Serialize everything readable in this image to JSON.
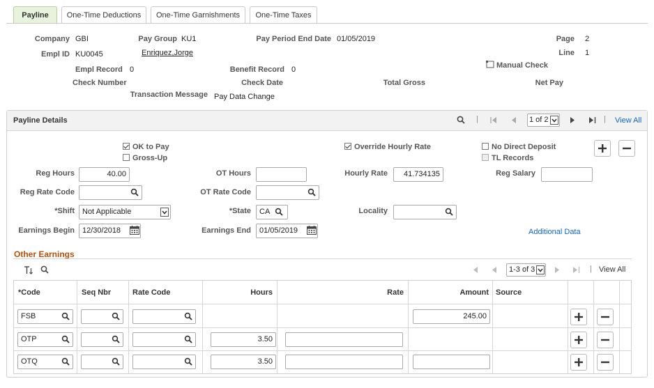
{
  "tabs": [
    {
      "label": "Payline"
    },
    {
      "label": "One-Time Deductions"
    },
    {
      "label": "One-Time Garnishments"
    },
    {
      "label": "One-Time Taxes"
    }
  ],
  "header": {
    "company_label": "Company",
    "company_value": "GBI",
    "pay_group_label": "Pay Group",
    "pay_group_value": "KU1",
    "pay_period_label": "Pay Period End Date",
    "pay_period_value": "01/05/2019",
    "page_label": "Page",
    "page_value": "2",
    "empl_id_label": "Empl ID",
    "empl_id_value": "KU0045",
    "name_value": "Enriquez,Jorge",
    "line_label": "Line",
    "line_value": "1",
    "manual_check_label": "Manual Check",
    "empl_record_label": "Empl Record",
    "empl_record_value": "0",
    "benefit_record_label": "Benefit Record",
    "benefit_record_value": "0",
    "check_number_label": "Check Number",
    "check_date_label": "Check Date",
    "total_gross_label": "Total Gross",
    "net_pay_label": "Net Pay",
    "transaction_message_label": "Transaction Message",
    "transaction_message_value": "Pay Data Change"
  },
  "details": {
    "title": "Payline Details",
    "pager": "1 of 2",
    "view_all": "View All",
    "ok_to_pay": "OK to Pay",
    "gross_up": "Gross-Up",
    "override_hourly_rate": "Override Hourly Rate",
    "no_direct_deposit": "No Direct Deposit",
    "tl_records": "TL Records",
    "reg_hours_label": "Reg Hours",
    "reg_hours_value": "40.00",
    "ot_hours_label": "OT Hours",
    "ot_hours_value": "",
    "hourly_rate_label": "Hourly Rate",
    "hourly_rate_value": "41.734135",
    "reg_salary_label": "Reg Salary",
    "reg_salary_value": "",
    "reg_rate_code_label": "Reg Rate Code",
    "ot_rate_code_label": "OT Rate Code",
    "shift_label": "*Shift",
    "shift_value": "Not Applicable",
    "state_label": "*State",
    "state_value": "CA",
    "locality_label": "Locality",
    "earnings_begin_label": "Earnings Begin",
    "earnings_begin_value": "12/30/2018",
    "earnings_end_label": "Earnings End",
    "earnings_end_value": "01/05/2019",
    "additional_data": "Additional Data"
  },
  "other_earnings": {
    "title": "Other Earnings",
    "pager": "1-3 of 3",
    "view_all": "View All",
    "columns": [
      "*Code",
      "Seq Nbr",
      "Rate Code",
      "Hours",
      "Rate",
      "Amount",
      "Source"
    ],
    "rows": [
      {
        "code": "FSB",
        "hours": "",
        "rate": "",
        "amount": "245.00"
      },
      {
        "code": "OTP",
        "hours": "3.50",
        "rate": "",
        "amount": ""
      },
      {
        "code": "OTQ",
        "hours": "3.50",
        "rate": "",
        "amount": ""
      }
    ]
  },
  "colors": {
    "accent_tab": "#e8f3dd",
    "section_title": "#b0520f",
    "link": "#1764b8"
  }
}
